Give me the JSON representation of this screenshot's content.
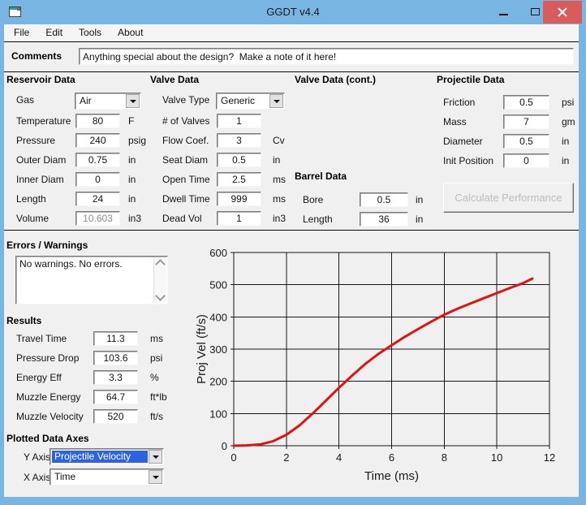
{
  "window": {
    "title": "GGDT v4.4"
  },
  "menu": {
    "items": [
      "File",
      "Edit",
      "Tools",
      "About"
    ]
  },
  "comments": {
    "label": "Comments",
    "value": "Anything special about the design?  Make a note of it here!"
  },
  "sections": {
    "reservoir": {
      "title": "Reservoir Data",
      "fields": [
        {
          "label": "Gas",
          "value": "Air",
          "unit": "",
          "control": "combo"
        },
        {
          "label": "Temperature",
          "value": "80",
          "unit": "F"
        },
        {
          "label": "Pressure",
          "value": "240",
          "unit": "psig"
        },
        {
          "label": "Outer Diam",
          "value": "0.75",
          "unit": "in"
        },
        {
          "label": "Inner Diam",
          "value": "0",
          "unit": "in"
        },
        {
          "label": "Length",
          "value": "24",
          "unit": "in"
        },
        {
          "label": "Volume",
          "value": "10.603",
          "unit": "in3",
          "control": "readonly"
        }
      ]
    },
    "valve": {
      "title": "Valve Data",
      "fields": [
        {
          "label": "Valve Type",
          "value": "Generic",
          "unit": "",
          "control": "combo"
        },
        {
          "label": "# of Valves",
          "value": "1",
          "unit": ""
        },
        {
          "label": "Flow Coef.",
          "value": "3",
          "unit": "Cv"
        },
        {
          "label": "Seat Diam",
          "value": "0.5",
          "unit": "in"
        },
        {
          "label": "Open Time",
          "value": "2.5",
          "unit": "ms"
        },
        {
          "label": "Dwell Time",
          "value": "999",
          "unit": "ms"
        },
        {
          "label": "Dead Vol",
          "value": "1",
          "unit": "in3"
        }
      ]
    },
    "valve_cont": {
      "title": "Valve Data (cont.)"
    },
    "barrel": {
      "title": "Barrel Data",
      "fields": [
        {
          "label": "Bore",
          "value": "0.5",
          "unit": "in"
        },
        {
          "label": "Length",
          "value": "36",
          "unit": "in"
        }
      ]
    },
    "projectile": {
      "title": "Projectile Data",
      "fields": [
        {
          "label": "Friction",
          "value": "0.5",
          "unit": "psi"
        },
        {
          "label": "Mass",
          "value": "7",
          "unit": "gm"
        },
        {
          "label": "Diameter",
          "value": "0.5",
          "unit": "in"
        },
        {
          "label": "Init Position",
          "value": "0",
          "unit": "in"
        }
      ],
      "button_label": "Calculate Performance"
    }
  },
  "errors": {
    "title": "Errors / Warnings",
    "text": "No warnings.  No errors."
  },
  "results": {
    "title": "Results",
    "fields": [
      {
        "label": "Travel Time",
        "value": "11.3",
        "unit": "ms"
      },
      {
        "label": "Pressure Drop",
        "value": "103.6",
        "unit": "psi"
      },
      {
        "label": "Energy Eff",
        "value": "3.3",
        "unit": "%"
      },
      {
        "label": "Muzzle Energy",
        "value": "64.7",
        "unit": "ft*lb"
      },
      {
        "label": "Muzzle Velocity",
        "value": "520",
        "unit": "ft/s"
      }
    ]
  },
  "plotted_axes": {
    "title": "Plotted Data Axes",
    "y_axis": {
      "label": "Y Axis",
      "value": "Projectile Velocity"
    },
    "x_axis": {
      "label": "X Axis",
      "value": "Time"
    }
  },
  "chart_data": {
    "type": "line",
    "title": "",
    "xlabel": "Time (ms)",
    "ylabel": "Proj Vel (ft/s)",
    "xlim": [
      0,
      12
    ],
    "ylim": [
      0,
      600
    ],
    "xticks": [
      0,
      2,
      4,
      6,
      8,
      10,
      12
    ],
    "yticks": [
      0,
      100,
      200,
      300,
      400,
      500,
      600
    ],
    "grid": true,
    "legend": "none",
    "series": [
      {
        "name": "Projectile Velocity vs Time",
        "color": "#dc1414",
        "x": [
          0,
          0.5,
          1,
          1.5,
          2,
          2.5,
          3,
          3.5,
          4,
          4.5,
          5,
          5.5,
          6,
          6.5,
          7,
          7.5,
          8,
          8.5,
          9,
          9.5,
          10,
          10.5,
          11,
          11.35
        ],
        "y": [
          0,
          1,
          4,
          14,
          34,
          63,
          100,
          140,
          180,
          218,
          254,
          285,
          312,
          338,
          362,
          385,
          407,
          425,
          442,
          458,
          474,
          490,
          505,
          519
        ]
      }
    ]
  },
  "icons": {
    "app": "vb-form-icon",
    "minimize": "minimize-icon",
    "maximize": "maximize-icon",
    "close": "close-x-icon",
    "dropdown": "chevron-down-icon",
    "scroll_up": "chevron-up-icon",
    "scroll_down": "chevron-down-icon"
  },
  "colors": {
    "titlebar": "#79b5e3",
    "close_button": "#d95c5c",
    "selection": "#2f63dd",
    "curve": "#dc1414",
    "window_bg": "#f0f0f0"
  }
}
